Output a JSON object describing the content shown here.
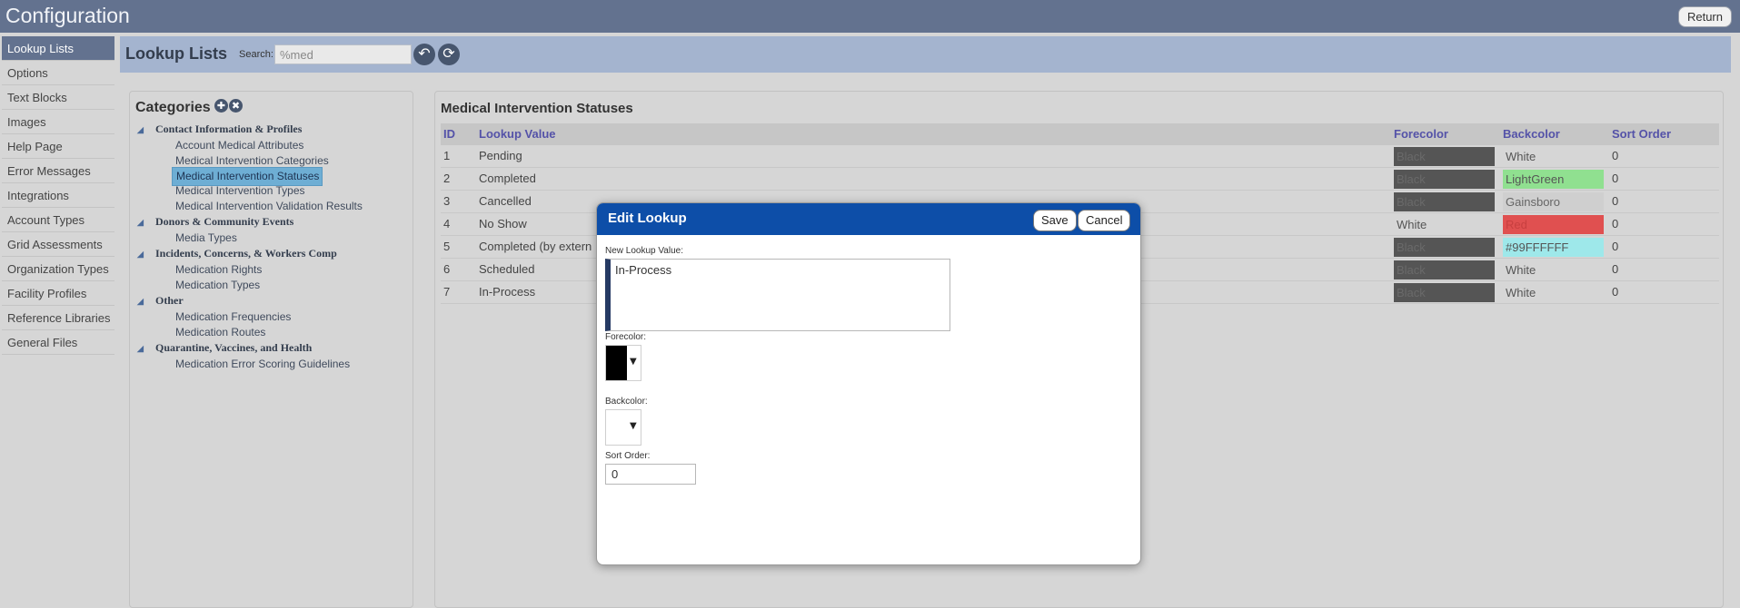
{
  "app": {
    "title": "Configuration",
    "return_label": "Return"
  },
  "sidebar": {
    "items": [
      {
        "label": "Lookup Lists",
        "active": true
      },
      {
        "label": "Options"
      },
      {
        "label": "Text Blocks"
      },
      {
        "label": "Images"
      },
      {
        "label": "Help Page"
      },
      {
        "label": "Error Messages"
      },
      {
        "label": "Integrations"
      },
      {
        "label": "Account Types"
      },
      {
        "label": "Grid Assessments"
      },
      {
        "label": "Organization Types"
      },
      {
        "label": "Facility Profiles"
      },
      {
        "label": "Reference Libraries"
      },
      {
        "label": "General Files"
      }
    ]
  },
  "header": {
    "title": "Lookup Lists",
    "search_label": "Search:",
    "search_value": "%med"
  },
  "categories": {
    "title": "Categories",
    "groups": [
      {
        "label": "Contact Information & Profiles",
        "children": [
          "Account Medical Attributes",
          "Medical Intervention Categories",
          "Medical Intervention Statuses",
          "Medical Intervention Types",
          "Medical Intervention Validation Results"
        ]
      },
      {
        "label": "Donors & Community Events",
        "children": [
          "Media Types"
        ]
      },
      {
        "label": "Incidents, Concerns, & Workers Comp",
        "children": [
          "Medication Rights",
          "Medication Types"
        ]
      },
      {
        "label": "Other",
        "children": [
          "Medication Frequencies",
          "Medication Routes"
        ]
      },
      {
        "label": "Quarantine, Vaccines, and Health",
        "children": [
          "Medication Error Scoring Guidelines"
        ]
      }
    ],
    "selected": "Medical Intervention Statuses"
  },
  "grid": {
    "title": "Medical Intervention Statuses",
    "columns": {
      "id": "ID",
      "value": "Lookup Value",
      "forecolor": "Forecolor",
      "backcolor": "Backcolor",
      "sort": "Sort Order"
    },
    "rows": [
      {
        "id": "1",
        "value": "Pending",
        "forecolor": "Black",
        "backcolor": "White",
        "sort": "0"
      },
      {
        "id": "2",
        "value": "Completed",
        "forecolor": "Black",
        "backcolor": "LightGreen",
        "sort": "0"
      },
      {
        "id": "3",
        "value": "Cancelled",
        "forecolor": "Black",
        "backcolor": "Gainsboro",
        "sort": "0"
      },
      {
        "id": "4",
        "value": "No Show",
        "forecolor": "White",
        "backcolor": "Red",
        "sort": "0"
      },
      {
        "id": "5",
        "value": "Completed (by extern",
        "forecolor": "Black",
        "backcolor": "#99FFFFFF",
        "sort": "0"
      },
      {
        "id": "6",
        "value": "Scheduled",
        "forecolor": "Black",
        "backcolor": "White",
        "sort": "0"
      },
      {
        "id": "7",
        "value": "In-Process",
        "forecolor": "Black",
        "backcolor": "White",
        "sort": "0"
      }
    ]
  },
  "dialog": {
    "title": "Edit Lookup",
    "save_label": "Save",
    "cancel_label": "Cancel",
    "lookup_label": "New Lookup Value:",
    "lookup_value": "In-Process",
    "forecolor_label": "Forecolor:",
    "forecolor_value": "#000000",
    "backcolor_label": "Backcolor:",
    "backcolor_value": "#ffffff",
    "sort_label": "Sort Order:",
    "sort_value": "0"
  },
  "colors": {
    "titlebar": "#63728f",
    "header": "#a4b4cf",
    "dialog_bar": "#0d4ea8",
    "fore_black_swatch": "#555555",
    "light_green": "#90ee90",
    "gainsboro": "#dcdcdc",
    "red": "#e65050",
    "cyan": "#a6eef0"
  }
}
